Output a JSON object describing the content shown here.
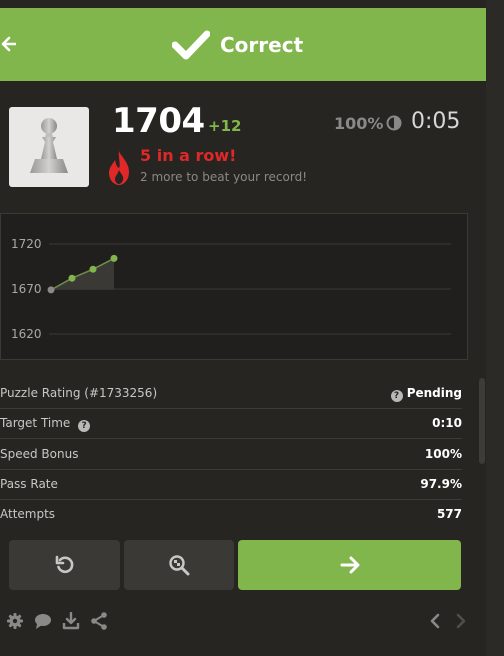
{
  "header": {
    "title": "Correct",
    "back_icon": "arrow-left-icon",
    "status_icon": "checkmark-icon",
    "color": "#81b64c"
  },
  "stats": {
    "rating": "1704",
    "rating_delta": "+12",
    "accuracy": "100%",
    "timer": "0:05",
    "streak": "5 in a row!",
    "record_hint": "2 more to beat your record!"
  },
  "chart_data": {
    "type": "line",
    "x": [
      1,
      2,
      3,
      4
    ],
    "values": [
      1669,
      1682,
      1692,
      1704
    ],
    "y_ticks": [
      "1720",
      "1670",
      "1620"
    ],
    "ylim": [
      1620,
      1720
    ],
    "grid": true
  },
  "details": {
    "rows": [
      {
        "label": "Puzzle Rating (#1733256)",
        "value": "Pending"
      },
      {
        "label": "Target Time",
        "value": "0:10"
      },
      {
        "label": "Speed Bonus",
        "value": "100%"
      },
      {
        "label": "Pass Rate",
        "value": "97.9%"
      },
      {
        "label": "Attempts",
        "value": "577"
      }
    ]
  },
  "actions": {
    "retry_icon": "retry-icon",
    "analysis_icon": "analysis-icon",
    "next_icon": "arrow-right-icon"
  },
  "toolbar": {
    "icons": [
      "gear-icon",
      "chat-icon",
      "download-icon",
      "share-icon",
      "chevron-left-icon",
      "chevron-right-icon"
    ]
  },
  "colors": {
    "accent": "#81b64c",
    "streak": "#e02828",
    "background": "#262522"
  }
}
